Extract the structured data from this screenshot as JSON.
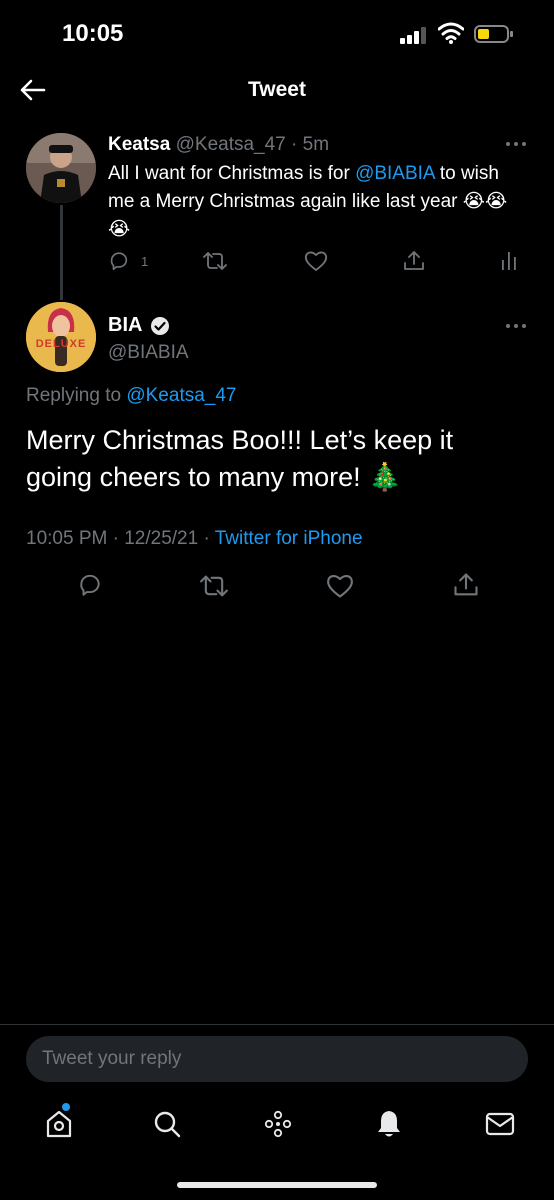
{
  "status_bar": {
    "time": "10:05"
  },
  "header": {
    "title": "Tweet"
  },
  "parent_tweet": {
    "name": "Keatsa",
    "handle": "@Keatsa_47",
    "separator": " · ",
    "time_ago": "5m",
    "text_before": "All I want for Christmas is for ",
    "mention": "@BIABIA",
    "text_after": " to wish me a Merry Christmas again like last year ",
    "emojis": "😭😭😭",
    "reply_count": "1"
  },
  "main_tweet": {
    "name": "BIA",
    "handle": "@BIABIA",
    "replying_label": "Replying to ",
    "replying_to": "@Keatsa_47",
    "text": "Merry Christmas Boo!!! Let’s keep it going cheers to many more! ",
    "emoji": "🎄",
    "timestamp": "10:05 PM · 12/25/21 · ",
    "source": "Twitter for iPhone",
    "avatar_text": "DELUXE"
  },
  "reply_box": {
    "placeholder": "Tweet your reply"
  },
  "colors": {
    "accent": "#1d9bf0",
    "background": "#000000",
    "muted": "#71767b"
  },
  "icons": [
    "back-arrow-icon",
    "more-icon",
    "reply-icon",
    "retweet-icon",
    "like-icon",
    "share-icon",
    "analytics-icon",
    "verified-icon",
    "home-icon",
    "search-icon",
    "spaces-icon",
    "notifications-icon",
    "messages-icon"
  ]
}
